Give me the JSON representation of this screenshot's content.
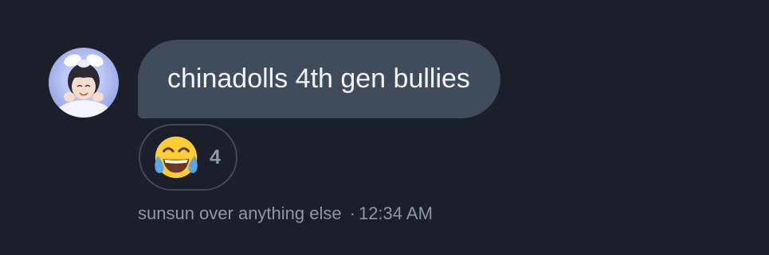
{
  "message": {
    "text": "chinadolls 4th gen bullies",
    "bubble_color": "#3f4c5c",
    "text_color": "#f2f4f6"
  },
  "reaction": {
    "emoji_icon": "face-with-tears-of-joy-icon",
    "count": "4"
  },
  "meta": {
    "sender": "sunsun over anything else",
    "separator": "·",
    "time": "12:34 AM"
  },
  "theme": {
    "background": "#1a1f29",
    "muted_text": "#8b98a5",
    "border": "#3e4a58"
  }
}
